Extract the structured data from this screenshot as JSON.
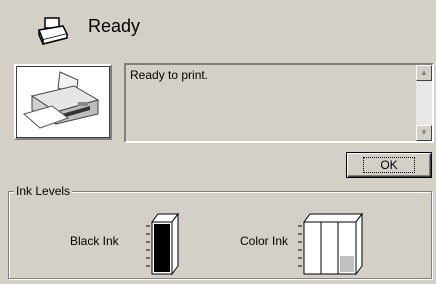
{
  "status": {
    "title": "Ready",
    "icon": "printer-icon"
  },
  "message": {
    "text": "Ready to print."
  },
  "buttons": {
    "ok_label": "OK"
  },
  "ink": {
    "legend": "Ink Levels",
    "black": {
      "label": "Black Ink",
      "level": 1.0
    },
    "color": {
      "label": "Color Ink",
      "levels": [
        1.0,
        1.0,
        0.35
      ]
    }
  }
}
